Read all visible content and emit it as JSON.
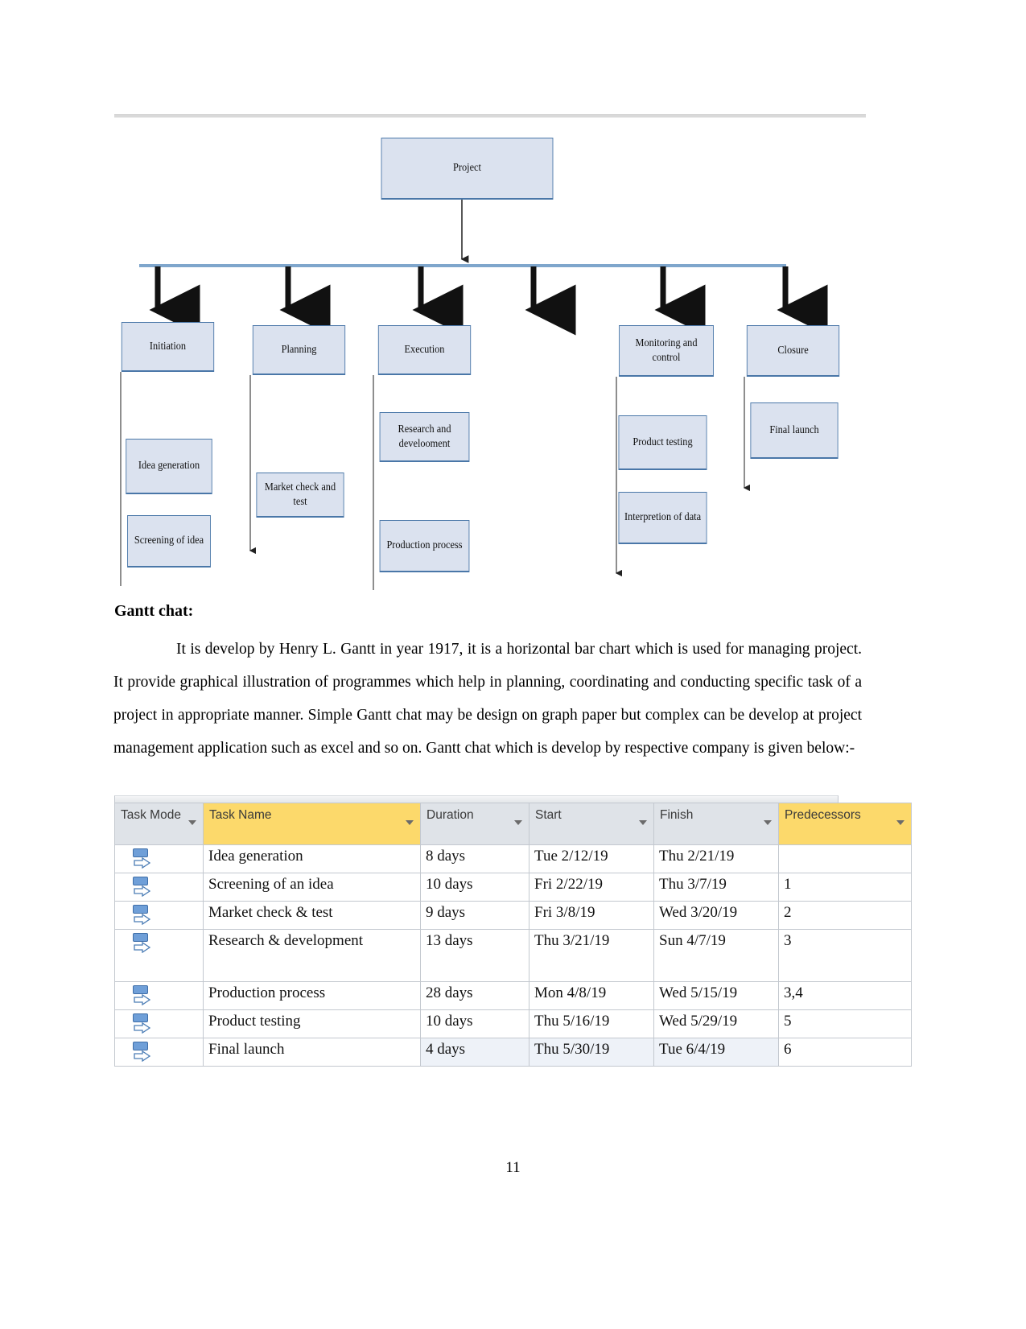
{
  "document": {
    "page_number": "11",
    "heading": "Gantt chat:",
    "paragraph": "It is develop by Henry L. Gantt in year 1917, it is a horizontal bar chart which is used for managing project. It provide graphical illustration of programmes which help in planning, coordinating and conducting specific task of a project in appropriate manner.  Simple Gantt chat may be design on graph paper but complex can be develop at project management application such as excel and so on. Gantt chat which is develop by respective company is given below:-"
  },
  "diagram": {
    "root": "Project",
    "phases": [
      "Initiation",
      "Planning",
      "Execution",
      "Monitoring and control",
      "Closure"
    ],
    "sub_nodes": [
      "Idea generation",
      "Screening of idea",
      "Market check and test",
      "Research and develooment",
      "Production process",
      "Product testing",
      "Interpretion of data",
      "Final launch"
    ],
    "colors": {
      "node_fill": "#dbe2ef",
      "node_border": "#4a77a8",
      "connector": "#000000"
    }
  },
  "gantt_table": {
    "columns": [
      {
        "label": "Task Mode",
        "highlight": false
      },
      {
        "label": "Task Name",
        "highlight": true
      },
      {
        "label": "Duration",
        "highlight": false
      },
      {
        "label": "Start",
        "highlight": false
      },
      {
        "label": "Finish",
        "highlight": false
      },
      {
        "label": "Predecessors",
        "highlight": true
      }
    ],
    "header_highlight_color": "#fcd96b",
    "header_color": "#dfe3e8",
    "rows": [
      {
        "mode": "manually-scheduled-icon",
        "name": "Idea generation",
        "duration": "8 days",
        "start": "Tue 2/12/19",
        "finish": "Thu 2/21/19",
        "predecessors": ""
      },
      {
        "mode": "manually-scheduled-icon",
        "name": "Screening of an idea",
        "duration": "10 days",
        "start": "Fri 2/22/19",
        "finish": "Thu 3/7/19",
        "predecessors": "1"
      },
      {
        "mode": "manually-scheduled-icon",
        "name": "Market check & test",
        "duration": "9 days",
        "start": "Fri 3/8/19",
        "finish": "Wed 3/20/19",
        "predecessors": "2"
      },
      {
        "mode": "manually-scheduled-icon",
        "name": "Research & development",
        "duration": "13 days",
        "start": "Thu 3/21/19",
        "finish": "Sun 4/7/19",
        "predecessors": "3"
      },
      {
        "mode": "manually-scheduled-icon",
        "name": "Production process",
        "duration": "28 days",
        "start": "Mon 4/8/19",
        "finish": "Wed 5/15/19",
        "predecessors": "3,4"
      },
      {
        "mode": "manually-scheduled-icon",
        "name": "Product testing",
        "duration": "10 days",
        "start": "Thu 5/16/19",
        "finish": "Wed 5/29/19",
        "predecessors": "5"
      },
      {
        "mode": "manually-scheduled-icon",
        "name": "Final launch",
        "duration": "4 days",
        "start": "Thu 5/30/19",
        "finish": "Tue 6/4/19",
        "predecessors": "6"
      }
    ]
  }
}
